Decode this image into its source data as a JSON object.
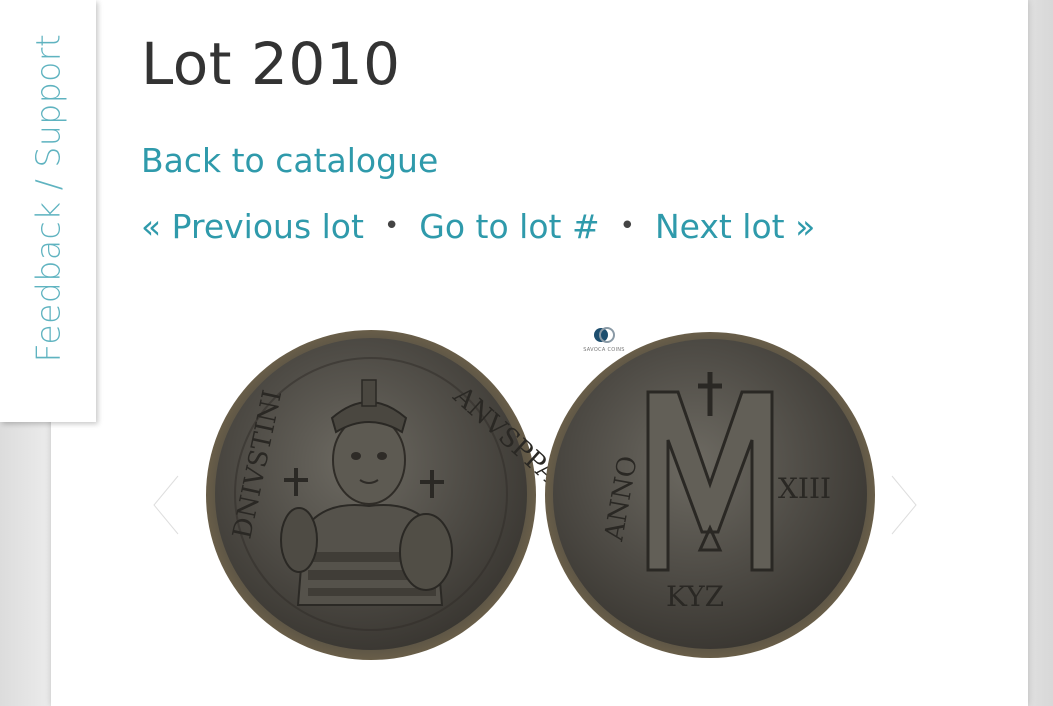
{
  "feedback": {
    "label": "Feedback / Support"
  },
  "lot": {
    "title": "Lot 2010"
  },
  "navigation": {
    "back_label": "Back to catalogue",
    "previous_label": "« Previous lot",
    "goto_label": "Go to lot #",
    "next_label": "Next lot »",
    "separator": "•"
  },
  "gallery": {
    "watermark_text": "SAVOCA COINS",
    "prev_icon": "chevron-left-icon",
    "next_icon": "chevron-right-icon"
  },
  "colors": {
    "link": "#2f9aab",
    "feedback": "#5fb3c0",
    "title": "#333333"
  }
}
